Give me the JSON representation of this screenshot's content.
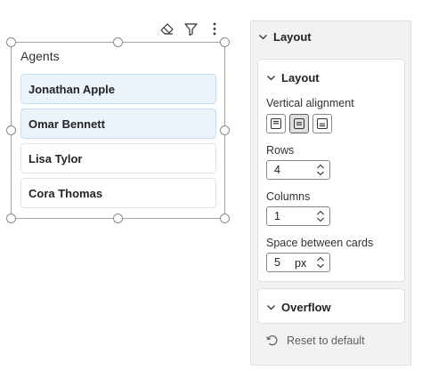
{
  "slicer": {
    "title": "Agents",
    "cards": [
      {
        "label": "Jonathan Apple",
        "selected": true
      },
      {
        "label": "Omar Bennett",
        "selected": true
      },
      {
        "label": "Lisa Tylor",
        "selected": false
      },
      {
        "label": "Cora Thomas",
        "selected": false
      }
    ],
    "toolbar_icons": [
      "eraser-icon",
      "filter-icon",
      "more-options-icon"
    ]
  },
  "format_pane": {
    "header": "Layout",
    "layout_section": {
      "title": "Layout",
      "vertical_alignment_label": "Vertical alignment",
      "vertical_alignment_options": [
        "top",
        "middle",
        "bottom"
      ],
      "vertical_alignment_selected": "middle",
      "rows_label": "Rows",
      "rows_value": "4",
      "columns_label": "Columns",
      "columns_value": "1",
      "spacing_label": "Space between cards",
      "spacing_value": "5",
      "spacing_unit": "px"
    },
    "overflow_section": {
      "title": "Overflow"
    },
    "reset_label": "Reset to default"
  },
  "colors": {
    "selected_card": "#ebf3fc",
    "pane_background": "#f3f2f1",
    "border": "#a6a6a6"
  }
}
